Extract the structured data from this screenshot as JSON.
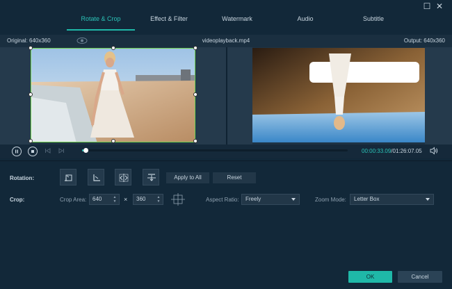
{
  "window": {
    "close_glyph": "✕",
    "maximize_glyph": "☐"
  },
  "tabs": [
    {
      "label": "Rotate & Crop",
      "active": true
    },
    {
      "label": "Effect & Filter",
      "active": false
    },
    {
      "label": "Watermark",
      "active": false
    },
    {
      "label": "Audio",
      "active": false
    },
    {
      "label": "Subtitle",
      "active": false
    }
  ],
  "preview": {
    "original_label": "Original: 640x360",
    "file_name": "videoplayback.mp4",
    "output_label": "Output: 640x360"
  },
  "playback": {
    "current_time": "00:00:33.09",
    "total_time": "/01:26:07.05",
    "progress_fraction": 0.006
  },
  "rotation": {
    "label": "Rotation:",
    "buttons": [
      {
        "icon": "rotate-left-icon"
      },
      {
        "icon": "rotate-right-icon"
      },
      {
        "icon": "flip-horizontal-icon"
      },
      {
        "icon": "flip-vertical-icon"
      }
    ],
    "apply_all_label": "Apply to All",
    "reset_label": "Reset"
  },
  "crop": {
    "label": "Crop:",
    "area_label": "Crop Area:",
    "width": "640",
    "height": "360",
    "times": "×",
    "aspect_label": "Aspect Ratio:",
    "aspect_value": "Freely",
    "zoom_label": "Zoom Mode:",
    "zoom_value": "Letter Box"
  },
  "footer": {
    "ok_label": "OK",
    "cancel_label": "Cancel"
  },
  "colors": {
    "accent": "#1fb8a8",
    "crop_frame": "#6fd24d",
    "background": "#122839"
  }
}
